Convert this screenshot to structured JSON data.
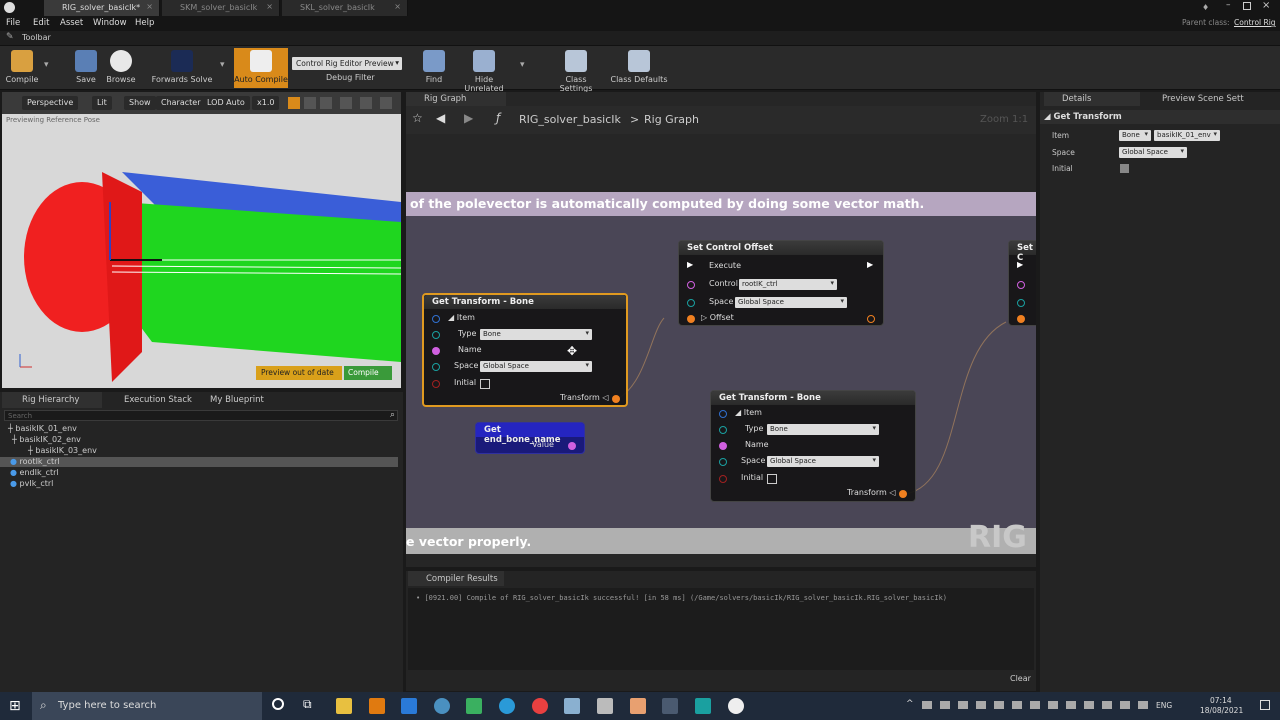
{
  "window": {
    "tabs": [
      "RIG_solver_basicIk*",
      "SKM_solver_basicIk",
      "SKL_solver_basicIk"
    ],
    "parent_class_label": "Parent class:",
    "parent_class": "Control Rig"
  },
  "menu": [
    "File",
    "Edit",
    "Asset",
    "Window",
    "Help"
  ],
  "toolbar": {
    "header": "Toolbar",
    "compile": "Compile",
    "save": "Save",
    "browse": "Browse",
    "forwards_solve": "Forwards Solve",
    "auto_compile": "Auto Compile",
    "preview_dropdown": "Control Rig Editor Preview",
    "debug_filter": "Debug Filter",
    "find": "Find",
    "hide_unrelated": "Hide Unrelated",
    "class_settings": "Class Settings",
    "class_defaults": "Class Defaults"
  },
  "viewport": {
    "perspective": "Perspective",
    "lit": "Lit",
    "show": "Show",
    "character": "Character",
    "lod": "LOD Auto",
    "speed": "x1.0",
    "previewing": "Previewing Reference Pose",
    "out_of_date": "Preview out of date",
    "compile": "Compile"
  },
  "left": {
    "tabs": [
      "Rig Hierarchy",
      "Execution Stack",
      "My Blueprint"
    ],
    "search_placeholder": "Search",
    "items": [
      "basikIK_01_env",
      "basikIK_02_env",
      "basikIK_03_env",
      "rootIk_ctrl",
      "endIk_ctrl",
      "pvIk_ctrl"
    ]
  },
  "graph": {
    "tab": "Rig Graph",
    "breadcrumb_asset": "RIG_solver_basicIk",
    "breadcrumb_sep": ">",
    "breadcrumb_graph": "Rig Graph",
    "zoom": "Zoom 1:1",
    "comment_top": "of the polevector is automatically computed by doing some vector math.",
    "comment_bottom": "e vector properly.",
    "watermark": "RIG",
    "node1": {
      "title": "Get Transform - Bone",
      "item": "Item",
      "type_label": "Type",
      "type_value": "Bone",
      "name_label": "Name",
      "space_label": "Space",
      "space_value": "Global Space",
      "initial_label": "Initial",
      "out_label": "Transform"
    },
    "node2": {
      "title": "Set Control Offset",
      "execute": "Execute",
      "control_label": "Control",
      "control_value": "rootIK_ctrl",
      "space_label": "Space",
      "space_value": "Global Space",
      "offset_label": "Offset"
    },
    "node3": {
      "title": "Get end_bone_name",
      "value": "Value"
    },
    "node4": {
      "title": "Get Transform - Bone",
      "item": "Item",
      "type_label": "Type",
      "type_value": "Bone",
      "name_label": "Name",
      "space_label": "Space",
      "space_value": "Global Space",
      "initial_label": "Initial",
      "out_label": "Transform"
    },
    "node5": {
      "title": "Set C"
    }
  },
  "details": {
    "tab": "Details",
    "tab2": "Preview Scene Sett",
    "section": "Get Transform",
    "item_label": "Item",
    "item_type": "Bone",
    "item_value": "basikIK_01_env",
    "space_label": "Space",
    "space_value": "Global Space",
    "initial_label": "Initial"
  },
  "compiler": {
    "tab": "Compiler Results",
    "message": "[0921.00] Compile of RIG_solver_basicIk successful! [in 58 ms] (/Game/solvers/basicIk/RIG_solver_basicIk.RIG_solver_basicIk)",
    "clear": "Clear"
  },
  "taskbar": {
    "search": "Type here to search",
    "lang": "ENG",
    "time": "07:14",
    "date": "18/08/2021"
  }
}
